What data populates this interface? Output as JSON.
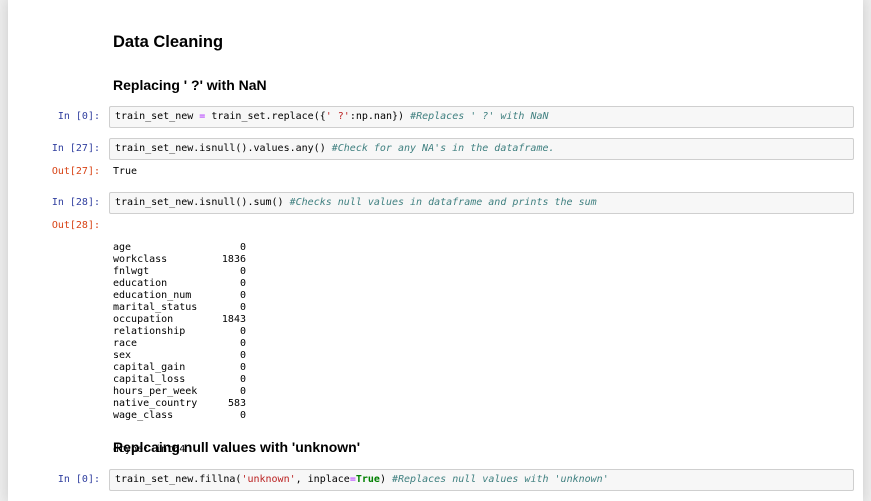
{
  "heading": "Data Cleaning",
  "subheading1": "Replacing ' ?' with NaN",
  "subheading2": "Replcaing null values with 'unknown'",
  "cells": [
    {
      "prompt": "In [0]:",
      "code": {
        "a": "train_set_new ",
        "op1": "=",
        "b": " train_set.replace({",
        "s1": "' ?'",
        "c": ":np.nan}) ",
        "cmt": "#Replaces ' ?' with NaN"
      }
    },
    {
      "prompt": "In [27]:",
      "code": {
        "a": "train_set_new.isnull().values.any() ",
        "cmt": "#Check for any NA's in the dataframe."
      },
      "out_prompt": "Out[27]:",
      "output": "True"
    },
    {
      "prompt": "In [28]:",
      "code": {
        "a": "train_set_new.isnull().sum() ",
        "cmt": "#Checks null values in dataframe and prints the sum"
      },
      "out_prompt": "Out[28]:"
    },
    {
      "prompt": "In [0]:",
      "code": {
        "a": "train_set_new.fillna(",
        "s1": "'unknown'",
        "b": ", inplace",
        "op1": "=",
        "kw": "True",
        "c": ") ",
        "cmt": "#Replaces null values with 'unknown'"
      }
    }
  ],
  "null_sums": [
    {
      "col": "age",
      "val": "0"
    },
    {
      "col": "workclass",
      "val": "1836"
    },
    {
      "col": "fnlwgt",
      "val": "0"
    },
    {
      "col": "education",
      "val": "0"
    },
    {
      "col": "education_num",
      "val": "0"
    },
    {
      "col": "marital_status",
      "val": "0"
    },
    {
      "col": "occupation",
      "val": "1843"
    },
    {
      "col": "relationship",
      "val": "0"
    },
    {
      "col": "race",
      "val": "0"
    },
    {
      "col": "sex",
      "val": "0"
    },
    {
      "col": "capital_gain",
      "val": "0"
    },
    {
      "col": "capital_loss",
      "val": "0"
    },
    {
      "col": "hours_per_week",
      "val": "0"
    },
    {
      "col": "native_country",
      "val": "583"
    },
    {
      "col": "wage_class",
      "val": "0"
    }
  ],
  "dtype_line": "dtype: int64"
}
